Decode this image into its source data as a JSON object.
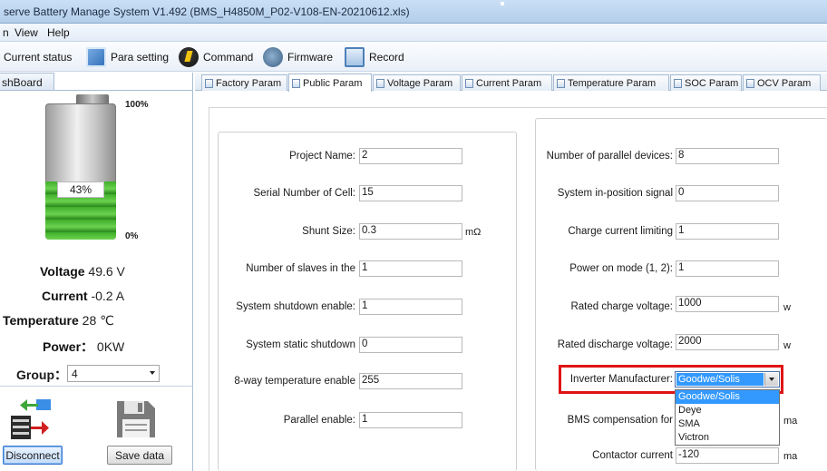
{
  "window": {
    "title": "serve Battery Manage System  V1.492   (BMS_H4850M_P02-V108-EN-20210612.xls)"
  },
  "menu": {
    "items": [
      "n",
      "View",
      "Help"
    ]
  },
  "toolbar": {
    "current_status": "Current status",
    "para_setting": "Para setting",
    "command": "Command",
    "firmware": "Firmware",
    "record": "Record"
  },
  "left_panel": {
    "header": "shBoard",
    "battery": {
      "percent_text": "43%",
      "level": 0.43,
      "max_label": "100%",
      "min_label": "0%"
    },
    "metrics": {
      "voltage_label": "Voltage",
      "voltage_value": "49.6 V",
      "current_label": "Current",
      "current_value": "-0.2 A",
      "temperature_label": "Temperature",
      "temperature_value": "28 ℃",
      "power_label": "Power：",
      "power_value": "0KW"
    },
    "group": {
      "label": "Group：",
      "value": "4"
    },
    "disconnect_label": "Disconnect",
    "save_label": "Save data"
  },
  "tabs": [
    "Factory Param",
    "Public Param",
    "Voltage Param",
    "Current Param",
    "Temperature Param",
    "SOC Param",
    "OCV Param"
  ],
  "active_tab": "Public Param",
  "public_param": {
    "left": [
      {
        "label": "Project Name:",
        "value": "2",
        "unit": ""
      },
      {
        "label": "Serial Number of Cell:",
        "value": "15",
        "unit": ""
      },
      {
        "label": "Shunt Size:",
        "value": "0.3",
        "unit": "mΩ"
      },
      {
        "label": "Number of slaves in the",
        "value": "1",
        "unit": ""
      },
      {
        "label": "System shutdown enable:",
        "value": "1",
        "unit": ""
      },
      {
        "label": "System static shutdown",
        "value": "0",
        "unit": ""
      },
      {
        "label": "8-way temperature enable",
        "value": "255",
        "unit": ""
      },
      {
        "label": "Parallel enable:",
        "value": "1",
        "unit": ""
      }
    ],
    "right": [
      {
        "label": "Number of parallel devices:",
        "value": "8",
        "unit": ""
      },
      {
        "label": "System in-position signal",
        "value": "0",
        "unit": ""
      },
      {
        "label": "Charge current limiting",
        "value": "1",
        "unit": ""
      },
      {
        "label": "Power on mode (1, 2):",
        "value": "1",
        "unit": ""
      },
      {
        "label": "Rated charge voltage:",
        "value": "1000",
        "unit": "w"
      },
      {
        "label": "Rated discharge voltage:",
        "value": "2000",
        "unit": "w"
      }
    ],
    "inverter": {
      "label": "Inverter Manufacturer:",
      "selected": "Goodwe/Solis",
      "options": [
        "Goodwe/Solis",
        "Deye",
        "SMA",
        "Victron"
      ]
    },
    "bms_compensation": {
      "label": "BMS compensation for",
      "unit": "ma"
    },
    "contactor_current": {
      "label": "Contactor current",
      "value": "-120",
      "unit": "ma"
    }
  },
  "colors": {
    "highlight": "#e01414",
    "selection": "#3399ff",
    "battery_green": "#3fae2a"
  }
}
